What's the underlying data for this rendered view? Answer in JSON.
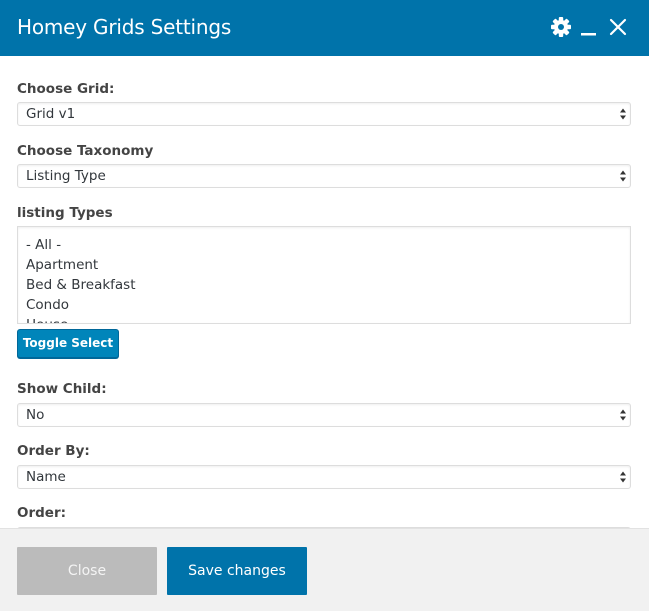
{
  "dialog": {
    "title": "Homey Grids Settings",
    "icons": {
      "settings": "gear-icon",
      "minimize": "minimize-icon",
      "close": "close-icon"
    }
  },
  "fields": {
    "grid": {
      "label": "Choose Grid:",
      "value": "Grid v1"
    },
    "taxonomy": {
      "label": "Choose Taxonomy",
      "value": "Listing Type"
    },
    "listing_types": {
      "label": "listing Types",
      "options": [
        "- All -",
        "Apartment",
        "Bed & Breakfast",
        "Condo",
        "House"
      ],
      "toggle_label": "Toggle Select"
    },
    "show_child": {
      "label": "Show Child:",
      "value": "No"
    },
    "order_by": {
      "label": "Order By:",
      "value": "Name"
    },
    "order": {
      "label": "Order:"
    }
  },
  "footer": {
    "close_label": "Close",
    "save_label": "Save changes"
  },
  "colors": {
    "primary": "#0073aa",
    "button": "#0085ba",
    "disabled": "#bbbbbb",
    "footer_bg": "#f1f1f1"
  }
}
